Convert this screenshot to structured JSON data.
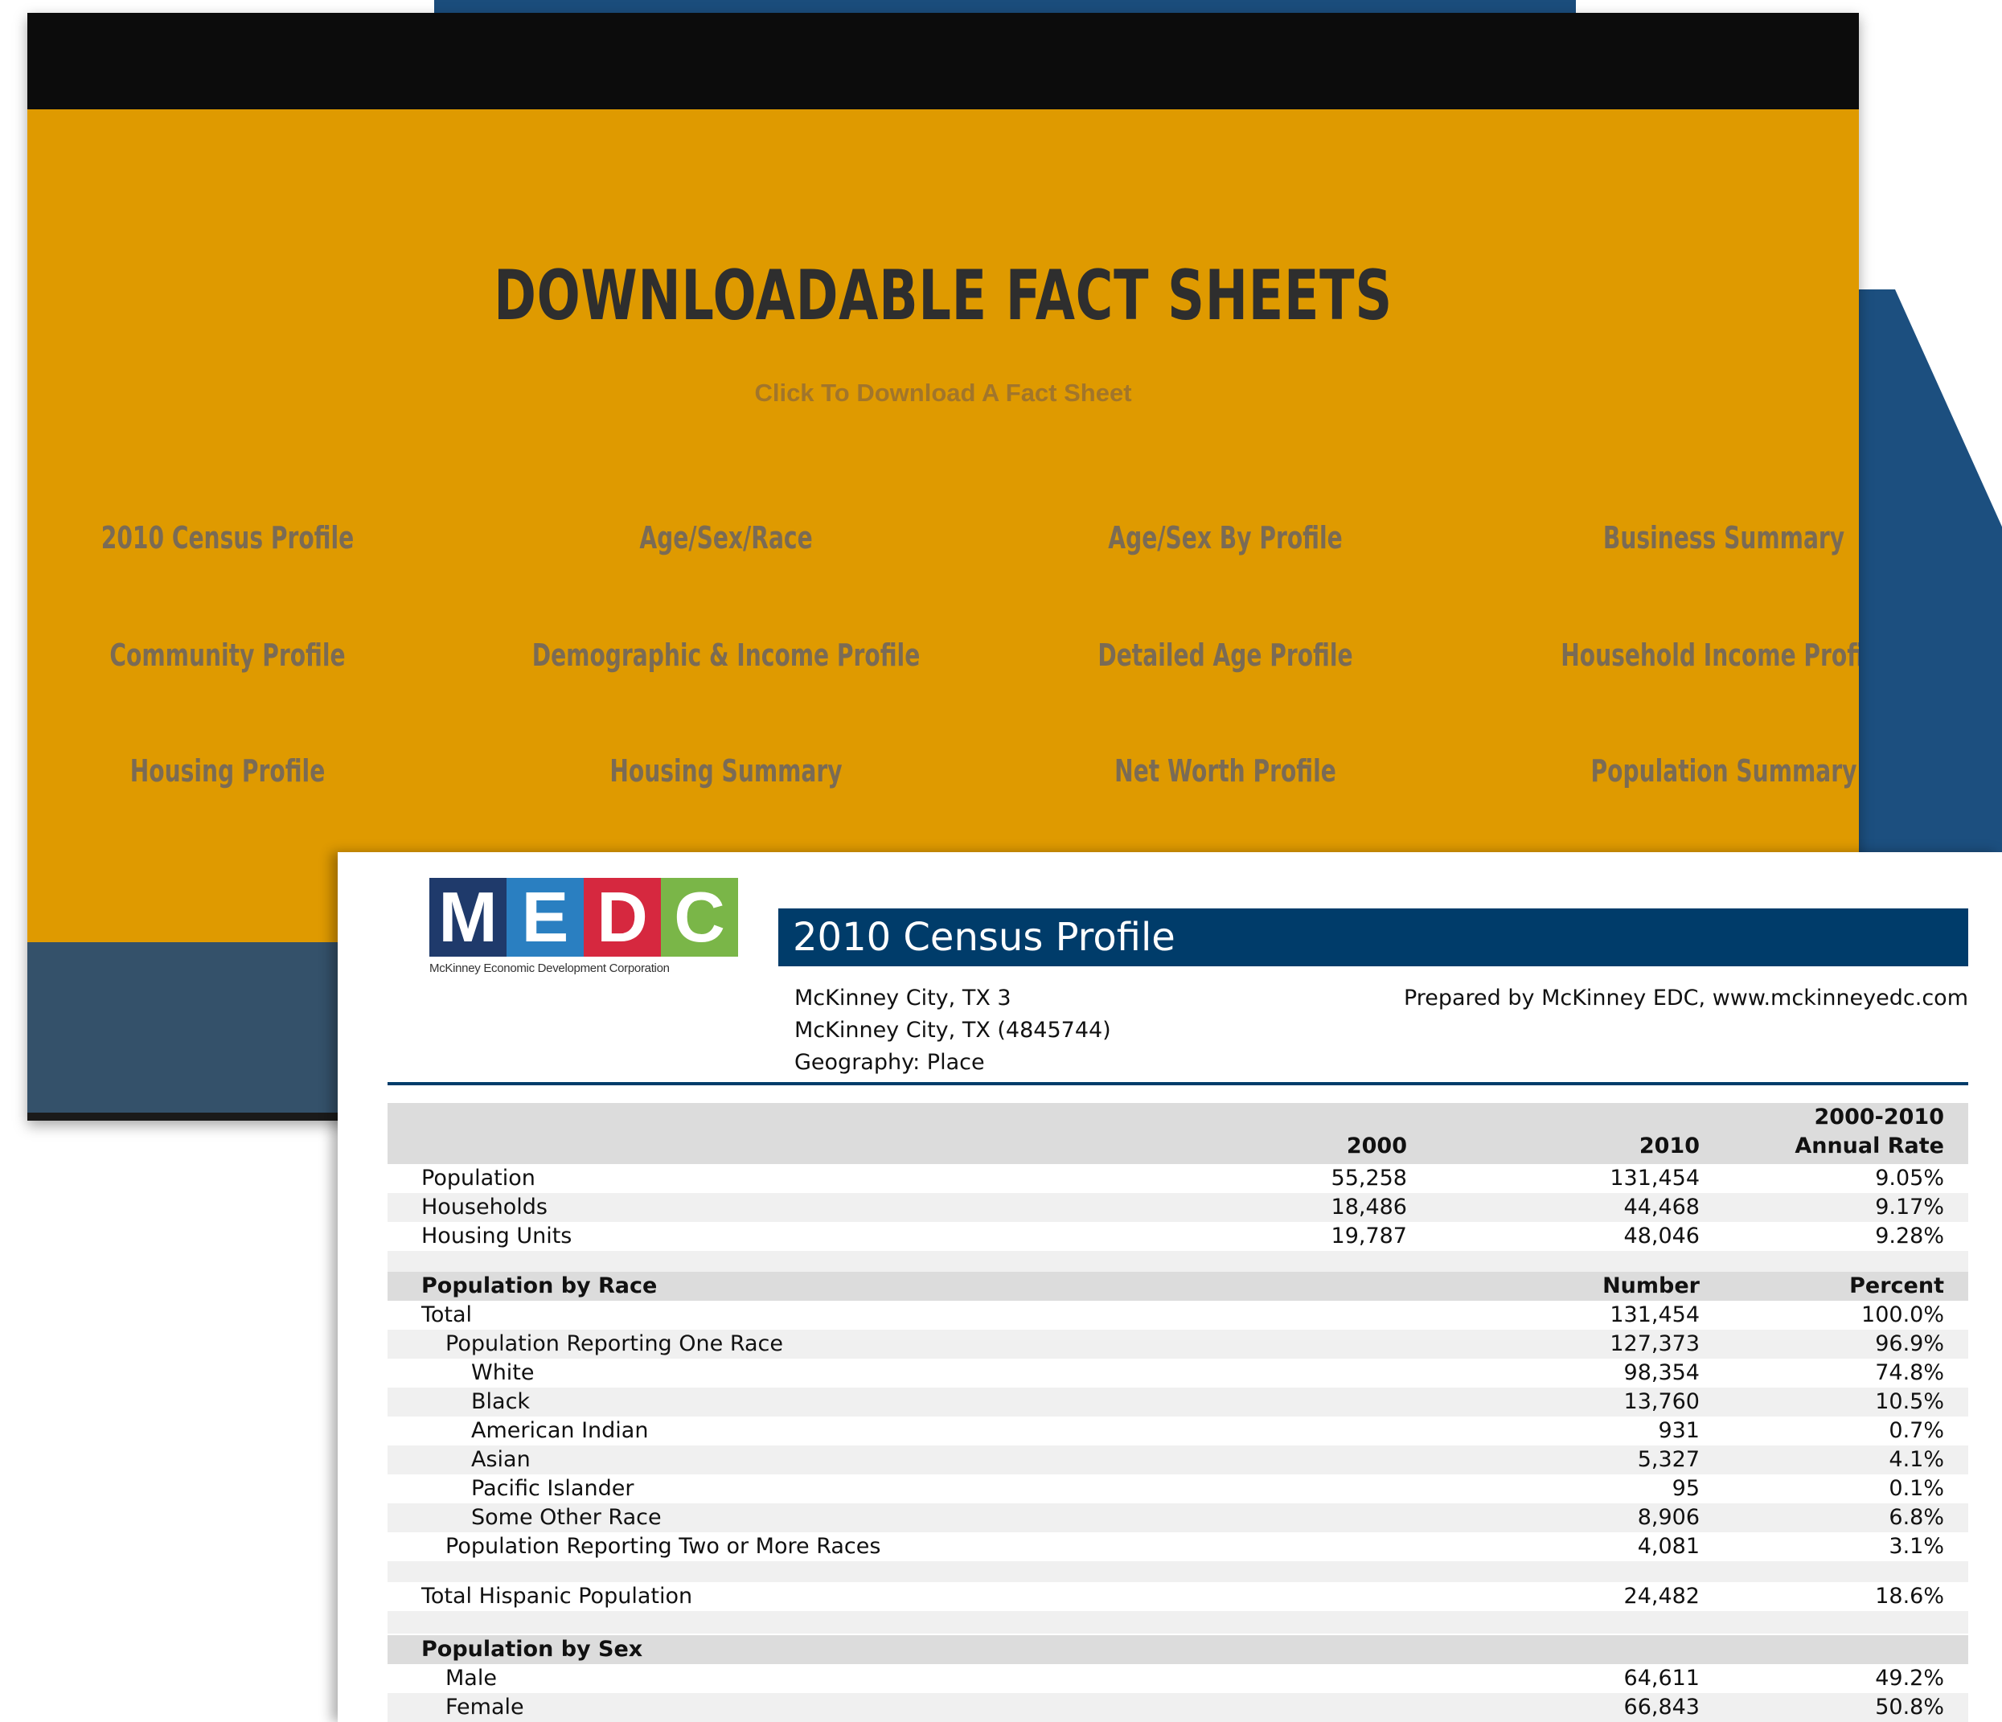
{
  "site": {
    "hero_title": "DOWNLOADABLE FACT SHEETS",
    "hero_subtitle": "Click To Download A Fact Sheet",
    "links": [
      "2010 Census Profile",
      "Age/Sex/Race",
      "Age/Sex By Profile",
      "Business Summary",
      "Community Profile",
      "Demographic & Income Profile",
      "Detailed Age Profile",
      "Household Income Profile",
      "Housing Profile",
      "Housing Summary",
      "Net Worth Profile",
      "Population Summary"
    ],
    "colors": {
      "hero": "#df9a00",
      "top_bar": "#0c0c0c",
      "footer": "#34516a"
    }
  },
  "doc": {
    "logo": {
      "letters": [
        "M",
        "E",
        "D",
        "C"
      ],
      "caption": "McKinney Economic Development Corporation",
      "colors": [
        "#1f3a6b",
        "#2a7fc1",
        "#d6283f",
        "#7ab648"
      ]
    },
    "title": "2010 Census Profile",
    "meta": [
      "McKinney City, TX 3",
      "McKinney City, TX (4845744)",
      "Geography: Place"
    ],
    "prepared_by": "Prepared by McKinney EDC, www.mckinneyedc.com",
    "summary": {
      "headers": {
        "c2000": "2000",
        "c2010": "2010",
        "rate_line1": "2000-2010",
        "rate_line2": "Annual Rate"
      },
      "rows": [
        {
          "label": "Population",
          "v2000": "55,258",
          "v2010": "131,454",
          "rate": "9.05%"
        },
        {
          "label": "Households",
          "v2000": "18,486",
          "v2010": "44,468",
          "rate": "9.17%"
        },
        {
          "label": "Housing Units",
          "v2000": "19,787",
          "v2010": "48,046",
          "rate": "9.28%"
        }
      ]
    },
    "race": {
      "title": "Population by Race",
      "h_number": "Number",
      "h_percent": "Percent",
      "rows": [
        {
          "label": "Total",
          "number": "131,454",
          "percent": "100.0%"
        },
        {
          "label": "Population Reporting One Race",
          "number": "127,373",
          "percent": "96.9%"
        },
        {
          "label": "White",
          "number": "98,354",
          "percent": "74.8%"
        },
        {
          "label": "Black",
          "number": "13,760",
          "percent": "10.5%"
        },
        {
          "label": "American Indian",
          "number": "931",
          "percent": "0.7%"
        },
        {
          "label": "Asian",
          "number": "5,327",
          "percent": "4.1%"
        },
        {
          "label": "Pacific Islander",
          "number": "95",
          "percent": "0.1%"
        },
        {
          "label": "Some Other Race",
          "number": "8,906",
          "percent": "6.8%"
        },
        {
          "label": "Population Reporting Two or More Races",
          "number": "4,081",
          "percent": "3.1%"
        }
      ],
      "hispanic": {
        "label": "Total Hispanic Population",
        "number": "24,482",
        "percent": "18.6%"
      }
    },
    "sex": {
      "title": "Population by Sex",
      "rows": [
        {
          "label": "Male",
          "number": "64,611",
          "percent": "49.2%"
        },
        {
          "label": "Female",
          "number": "66,843",
          "percent": "50.8%"
        }
      ]
    }
  }
}
